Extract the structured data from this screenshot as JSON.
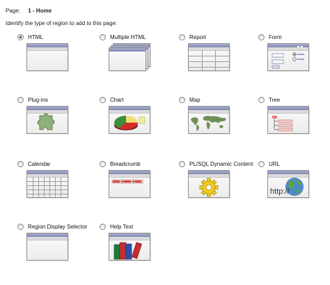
{
  "page": {
    "label": "Page:",
    "value": "1 - Home"
  },
  "instruction": "Identify the type of region to add to this page:",
  "options": [
    {
      "key": "html",
      "label": "HTML",
      "selected": true,
      "icon": "html-window-icon"
    },
    {
      "key": "multiple_html",
      "label": "Multiple HTML",
      "selected": false,
      "icon": "multiple-windows-icon"
    },
    {
      "key": "report",
      "label": "Report",
      "selected": false,
      "icon": "report-table-icon"
    },
    {
      "key": "form",
      "label": "Form",
      "selected": false,
      "icon": "form-icon"
    },
    {
      "key": "plugins",
      "label": "Plug-ins",
      "selected": false,
      "icon": "puzzle-icon"
    },
    {
      "key": "chart",
      "label": "Chart",
      "selected": false,
      "icon": "pie-chart-icon"
    },
    {
      "key": "map",
      "label": "Map",
      "selected": false,
      "icon": "world-map-icon"
    },
    {
      "key": "tree",
      "label": "Tree",
      "selected": false,
      "icon": "tree-icon"
    },
    {
      "key": "calendar",
      "label": "Calendar",
      "selected": false,
      "icon": "calendar-icon"
    },
    {
      "key": "breadcrumb",
      "label": "Breadcrumb",
      "selected": false,
      "icon": "breadcrumb-icon"
    },
    {
      "key": "plsql",
      "label": "PL/SQL Dynamic Content",
      "selected": false,
      "icon": "gear-icon"
    },
    {
      "key": "url",
      "label": "URL",
      "selected": false,
      "icon": "globe-url-icon",
      "thumb_text": "http://"
    },
    {
      "key": "region_selector",
      "label": "Region Display Selector",
      "selected": false,
      "icon": "region-selector-window-icon"
    },
    {
      "key": "help_text",
      "label": "Help Text",
      "selected": false,
      "icon": "books-icon"
    }
  ],
  "colors": {
    "title_bar": "#7f89b0",
    "puzzle_green": "#8fb07a",
    "map_green": "#6f8f55",
    "gear_yellow": "#f2cf1e"
  }
}
